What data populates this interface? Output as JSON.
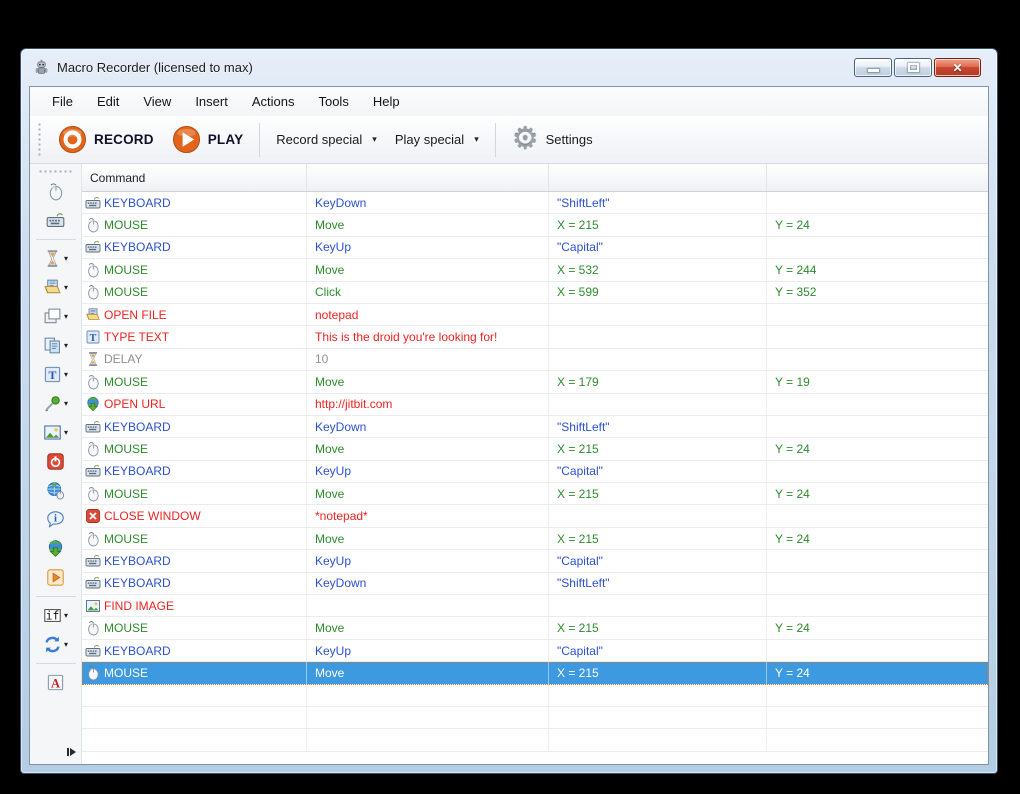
{
  "window": {
    "title": "Macro Recorder (licensed to max)"
  },
  "menu": {
    "items": [
      "File",
      "Edit",
      "View",
      "Insert",
      "Actions",
      "Tools",
      "Help"
    ]
  },
  "toolbar": {
    "record_label": "RECORD",
    "play_label": "PLAY",
    "record_special_label": "Record special",
    "play_special_label": "Play special",
    "settings_label": "Settings"
  },
  "sidebar": {
    "items": [
      {
        "icon": "mouse",
        "name": "insert-mouse",
        "dropdown": false
      },
      {
        "icon": "keyboard",
        "name": "insert-keyboard",
        "dropdown": false
      },
      {
        "separator": true
      },
      {
        "icon": "hourglass",
        "name": "insert-delay",
        "dropdown": true
      },
      {
        "icon": "openfile",
        "name": "open-file",
        "dropdown": true
      },
      {
        "icon": "window",
        "name": "window-command",
        "dropdown": true
      },
      {
        "icon": "copy",
        "name": "clipboard-command",
        "dropdown": true
      },
      {
        "icon": "typetext",
        "name": "type-text",
        "dropdown": true
      },
      {
        "icon": "picker",
        "name": "color-picker",
        "dropdown": true
      },
      {
        "icon": "image",
        "name": "find-image",
        "dropdown": true
      },
      {
        "icon": "power",
        "name": "shutdown-command",
        "dropdown": false
      },
      {
        "icon": "globemouse",
        "name": "web-recording",
        "dropdown": false
      },
      {
        "icon": "info",
        "name": "show-message",
        "dropdown": false
      },
      {
        "icon": "globeup",
        "name": "open-url",
        "dropdown": false
      },
      {
        "icon": "launch",
        "name": "launch-program",
        "dropdown": false
      },
      {
        "separator": true
      },
      {
        "icon": "if",
        "name": "if-statement",
        "dropdown": true
      },
      {
        "icon": "loop",
        "name": "loop-command",
        "dropdown": true
      },
      {
        "separator": true
      },
      {
        "icon": "font",
        "name": "text-recognition",
        "dropdown": false
      }
    ]
  },
  "table": {
    "columns": [
      "Command",
      "",
      "",
      ""
    ],
    "rows": [
      {
        "icon": "keyboard",
        "kind": "keyboard",
        "cells": [
          "KEYBOARD",
          "KeyDown",
          "\"ShiftLeft\"",
          ""
        ]
      },
      {
        "icon": "mouse",
        "kind": "mouse",
        "cells": [
          "MOUSE",
          "Move",
          "X = 215",
          "Y = 24"
        ]
      },
      {
        "icon": "keyboard",
        "kind": "keyboard",
        "cells": [
          "KEYBOARD",
          "KeyUp",
          "\"Capital\"",
          ""
        ]
      },
      {
        "icon": "mouse",
        "kind": "mouse",
        "cells": [
          "MOUSE",
          "Move",
          "X = 532",
          "Y = 244"
        ]
      },
      {
        "icon": "mouse",
        "kind": "mouse",
        "cells": [
          "MOUSE",
          "Click",
          "X = 599",
          "Y = 352"
        ]
      },
      {
        "icon": "openfile",
        "kind": "action",
        "cells": [
          "OPEN FILE",
          "notepad",
          "",
          ""
        ]
      },
      {
        "icon": "typetext",
        "kind": "action",
        "cells": [
          "TYPE TEXT",
          "This is the droid you're looking for!",
          "",
          ""
        ]
      },
      {
        "icon": "hourglass",
        "kind": "delay",
        "cells": [
          "DELAY",
          "10",
          "",
          ""
        ]
      },
      {
        "icon": "mouse",
        "kind": "mouse",
        "cells": [
          "MOUSE",
          "Move",
          "X = 179",
          "Y = 19"
        ]
      },
      {
        "icon": "globeup",
        "kind": "action",
        "cells": [
          "OPEN URL",
          "http://jitbit.com",
          "",
          ""
        ]
      },
      {
        "icon": "keyboard",
        "kind": "keyboard",
        "cells": [
          "KEYBOARD",
          "KeyDown",
          "\"ShiftLeft\"",
          ""
        ]
      },
      {
        "icon": "mouse",
        "kind": "mouse",
        "cells": [
          "MOUSE",
          "Move",
          "X = 215",
          "Y = 24"
        ]
      },
      {
        "icon": "keyboard",
        "kind": "keyboard",
        "cells": [
          "KEYBOARD",
          "KeyUp",
          "\"Capital\"",
          ""
        ]
      },
      {
        "icon": "mouse",
        "kind": "mouse",
        "cells": [
          "MOUSE",
          "Move",
          "X = 215",
          "Y = 24"
        ]
      },
      {
        "icon": "closewindow",
        "kind": "action",
        "cells": [
          "CLOSE WINDOW",
          "*notepad*",
          "",
          ""
        ]
      },
      {
        "icon": "mouse",
        "kind": "mouse",
        "cells": [
          "MOUSE",
          "Move",
          "X = 215",
          "Y = 24"
        ]
      },
      {
        "icon": "keyboard",
        "kind": "keyboard",
        "cells": [
          "KEYBOARD",
          "KeyUp",
          "\"Capital\"",
          ""
        ]
      },
      {
        "icon": "keyboard",
        "kind": "keyboard",
        "cells": [
          "KEYBOARD",
          "KeyDown",
          "\"ShiftLeft\"",
          ""
        ]
      },
      {
        "icon": "image",
        "kind": "action",
        "cells": [
          "FIND IMAGE",
          "",
          "",
          ""
        ]
      },
      {
        "icon": "mouse",
        "kind": "mouse",
        "cells": [
          "MOUSE",
          "Move",
          "X = 215",
          "Y = 24"
        ]
      },
      {
        "icon": "keyboard",
        "kind": "keyboard",
        "cells": [
          "KEYBOARD",
          "KeyUp",
          "\"Capital\"",
          ""
        ]
      },
      {
        "icon": "mouse",
        "kind": "mouse",
        "cells": [
          "MOUSE",
          "Move",
          "X = 215",
          "Y = 24"
        ],
        "selected": true
      }
    ],
    "selected_row_index": 21,
    "empty_row_count": 3
  },
  "colors": {
    "keyboard_text": "#2b50d0",
    "mouse_text": "#2e8b2e",
    "action_text": "#ee2222",
    "delay_text": "#8f8f8f",
    "selection_background": "#3d9ae1",
    "selection_text": "#ffffff",
    "record_accent": "#e2641b"
  }
}
